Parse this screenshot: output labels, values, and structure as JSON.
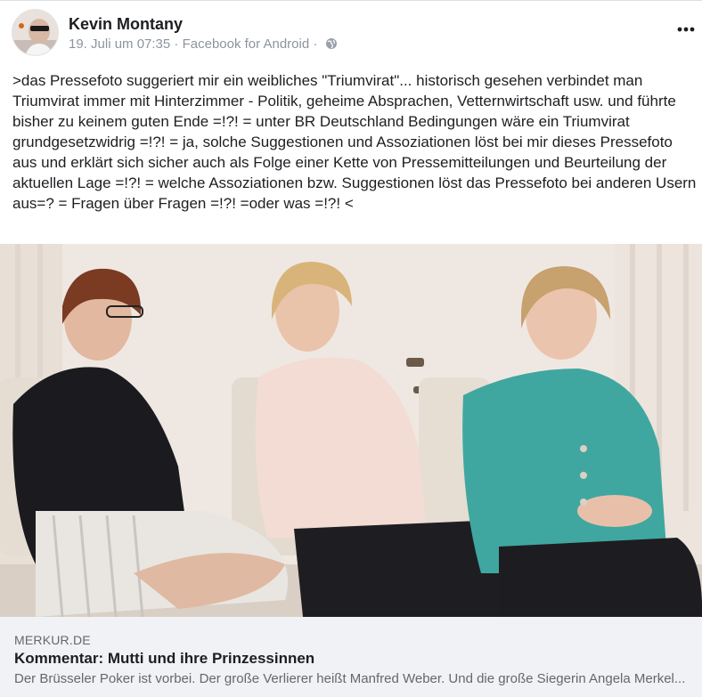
{
  "post": {
    "author_name": "Kevin Montany",
    "timestamp": "19. Juli um 07:35",
    "separator": "·",
    "source": "Facebook for Android",
    "separator2": "·",
    "privacy_icon": "globe-icon",
    "more_icon": "more-horizontal-icon",
    "avatar_icon": "avatar",
    "text": ">das Pressefoto suggeriert mir ein weibliches \"Triumvirat\"... historisch gesehen verbindet man Triumvirat immer mit Hinterzimmer - Politik, geheime Absprachen, Vetternwirtschaft usw. und führte bisher zu keinem guten Ende =!?! = unter BR Deutschland Bedingungen wäre ein Triumvirat grundgesetzwidrig =!?! = ja, solche Suggestionen und Assoziationen löst bei mir dieses Pressefoto aus und erklärt sich sicher auch als Folge einer Kette von Pressemitteilungen und Beurteilung der aktuellen Lage =!?! = welche Assoziationen bzw. Suggestionen löst das Pressefoto bei anderen Usern aus=? = Fragen über Fragen =!?! =oder was =!?! <"
  },
  "link_preview": {
    "domain": "MERKUR.DE",
    "title": "Kommentar: Mutti und ihre Prinzessinnen",
    "description": "Der Brüsseler Poker ist vorbei. Der große Verlierer heißt Manfred Weber. Und die große Siegerin Angela Merkel..."
  },
  "colors": {
    "text": "#1c1e21",
    "meta": "#8d949e",
    "preview_bg": "#f0f2f5"
  }
}
